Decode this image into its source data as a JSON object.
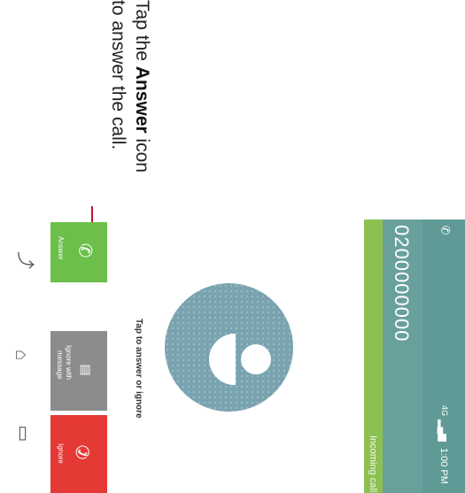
{
  "instruction": {
    "line1_prefix": "Tap the ",
    "line1_bold": "Answer",
    "line1_suffix": " icon",
    "line2": "to answer the call."
  },
  "status_bar": {
    "call_indicator_icon": "phone-icon",
    "network": "4G",
    "time": "1:00 PM"
  },
  "call": {
    "number": "0200000000",
    "status": "Incoming call",
    "prompt": "Tap to answer or ignore"
  },
  "buttons": {
    "answer": {
      "label": "Answer",
      "icon": "phone-icon",
      "color": "#6bbf4a"
    },
    "ignore_with_message": {
      "label_line1": "Ignore with",
      "label_line2": "message",
      "icon": "message-icon",
      "color": "#8c8c8c"
    },
    "ignore": {
      "label": "Ignore",
      "icon": "hang-up-icon",
      "color": "#e53935"
    }
  },
  "nav": {
    "back": "back-icon",
    "home": "home-icon",
    "recents": "recents-icon"
  },
  "colors": {
    "status_bar": "#5f9a96",
    "header": "#6aa09c",
    "accent": "#8cc152",
    "callout": "#c4122f"
  }
}
